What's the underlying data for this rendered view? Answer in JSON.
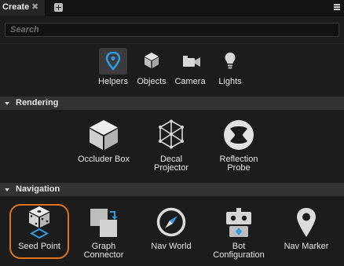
{
  "tab": {
    "title": "Create",
    "close": "✖"
  },
  "search": {
    "placeholder": "Search"
  },
  "categories": [
    {
      "label": "Helpers",
      "icon": "map-pin-icon",
      "active": true
    },
    {
      "label": "Objects",
      "icon": "cube-icon"
    },
    {
      "label": "Camera",
      "icon": "camera-icon"
    },
    {
      "label": "Lights",
      "icon": "lightbulb-icon"
    }
  ],
  "sections": {
    "rendering": {
      "title": "Rendering",
      "items": [
        {
          "l1": "Occluder Box",
          "l2": "",
          "icon": "cube-icon"
        },
        {
          "l1": "Decal",
          "l2": "Projector",
          "icon": "decal-projector-icon"
        },
        {
          "l1": "Reflection",
          "l2": "Probe",
          "icon": "reflection-probe-icon"
        }
      ]
    },
    "navigation": {
      "title": "Navigation",
      "items": [
        {
          "l1": "Seed Point",
          "l2": "",
          "icon": "dice-seed-icon",
          "selected": true
        },
        {
          "l1": "Graph",
          "l2": "Connector",
          "icon": "graph-connector-icon"
        },
        {
          "l1": "Nav World",
          "l2": "",
          "icon": "compass-icon"
        },
        {
          "l1": "Bot",
          "l2": "Configuration",
          "icon": "bot-icon"
        },
        {
          "l1": "Nav Marker",
          "l2": "",
          "icon": "map-pin-icon"
        }
      ]
    }
  },
  "colors": {
    "accent": "#2e9be0",
    "selection": "#e0741c",
    "section_bg": "#333333"
  }
}
